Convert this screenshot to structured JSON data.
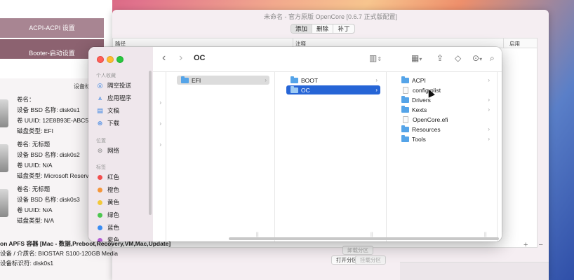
{
  "back_sidebar": {
    "items": [
      "ACPI-ACPI 设置",
      "Booter-启动设置"
    ]
  },
  "disk_panel": {
    "device_header": "设备标",
    "disks": [
      {
        "lines": [
          "卷名：",
          "设备 BSD 名称: disk0s1",
          "卷 UUID: 12E8B93E-ABC5-",
          "磁盘类型: EFI"
        ]
      },
      {
        "lines": [
          "卷名: 无标题",
          "设备 BSD 名称: disk0s2",
          "卷 UUID: N/A",
          "磁盘类型: Microsoft Reserve"
        ]
      },
      {
        "lines": [
          "卷名: 无标题",
          "设备 BSD 名称: disk0s3",
          "卷 UUID: N/A",
          "磁盘类型: N/A"
        ]
      }
    ],
    "apfs": {
      "title": "on APFS 容器 [Mac - 数据,Preboot,Recovery,VM,Mac,Update]",
      "media": "设备 / 介质名: BIOSTAR S100-120GB Media",
      "identifier": "设备标识符: disk0s1"
    },
    "buttons": {
      "unmount": "卸载分区",
      "open": "打开分区",
      "mount": "挂载分区"
    }
  },
  "oc_window": {
    "title": "未命名 - 官方原版 OpenCore [0.6.7 正式版配置]",
    "segments": [
      "添加",
      "删除",
      "补丁"
    ],
    "columns": [
      "路径",
      "注释",
      "启用"
    ],
    "add_remove": "+ −"
  },
  "finder": {
    "path_title": "OC",
    "sidebar": {
      "favorites_label": "个人收藏",
      "favorites": [
        {
          "icon": "airdrop-icon",
          "glyph": "◎",
          "label": "隔空投送"
        },
        {
          "icon": "applications-icon",
          "glyph": "⩓",
          "label": "应用程序"
        },
        {
          "icon": "documents-icon",
          "glyph": "▤",
          "label": "文稿"
        },
        {
          "icon": "downloads-icon",
          "glyph": "⊕",
          "label": "下载"
        }
      ],
      "locations_label": "位置",
      "locations": [
        {
          "icon": "network-icon",
          "glyph": "⊛",
          "label": "网络"
        }
      ],
      "tags_label": "标签",
      "tags": [
        {
          "label": "红色",
          "color": "#f24e4e"
        },
        {
          "label": "橙色",
          "color": "#f5963a"
        },
        {
          "label": "黄色",
          "color": "#f2c93a"
        },
        {
          "label": "绿色",
          "color": "#4cc64f"
        },
        {
          "label": "蓝色",
          "color": "#3a8cf2"
        },
        {
          "label": "紫色",
          "color": "#b45cd6"
        }
      ]
    },
    "columns": [
      {
        "items": [
          {
            "name": "EFI",
            "type": "folder",
            "state": "parent"
          }
        ]
      },
      {
        "items": [
          {
            "name": "BOOT",
            "type": "folder",
            "state": "normal"
          },
          {
            "name": "OC",
            "type": "folder",
            "state": "selected"
          }
        ]
      },
      {
        "items": [
          {
            "name": "ACPI",
            "type": "folder",
            "state": "normal"
          },
          {
            "name": "config.plist",
            "type": "file",
            "state": "normal"
          },
          {
            "name": "Drivers",
            "type": "folder",
            "state": "normal"
          },
          {
            "name": "Kexts",
            "type": "folder",
            "state": "normal"
          },
          {
            "name": "OpenCore.efi",
            "type": "file",
            "state": "normal"
          },
          {
            "name": "Resources",
            "type": "folder",
            "state": "normal"
          },
          {
            "name": "Tools",
            "type": "folder",
            "state": "normal"
          }
        ]
      }
    ]
  }
}
